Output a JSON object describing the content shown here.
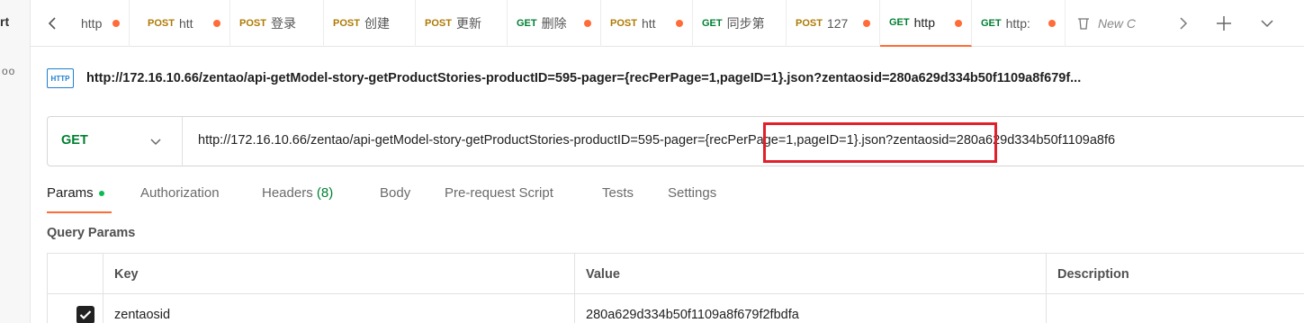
{
  "left_strip": {
    "label1": "rt",
    "label2": "oo"
  },
  "tabs": [
    {
      "method": "",
      "title": "http",
      "dot": true
    },
    {
      "method": "POST",
      "title": "htt",
      "dot": true
    },
    {
      "method": "POST",
      "title": "登录",
      "dot": false
    },
    {
      "method": "POST",
      "title": "创建",
      "dot": false
    },
    {
      "method": "POST",
      "title": "更新",
      "dot": false
    },
    {
      "method": "GET",
      "title": "删除",
      "dot": true
    },
    {
      "method": "POST",
      "title": "htt",
      "dot": true
    },
    {
      "method": "GET",
      "title": "同步第",
      "dot": false
    },
    {
      "method": "POST",
      "title": "127",
      "dot": true
    },
    {
      "method": "GET",
      "title": "http",
      "dot": true
    },
    {
      "method": "GET",
      "title": "http:",
      "dot": true
    }
  ],
  "new_tab_label": "New C",
  "request": {
    "badge": "HTTP",
    "title": "http://172.16.10.66/zentao/api-getModel-story-getProductStories-productID=595-pager={recPerPage=1,pageID=1}.json?zentaosid=280a629d334b50f1109a8f679f...",
    "method": "GET",
    "url": "http://172.16.10.66/zentao/api-getModel-story-getProductStories-productID=595-pager={recPerPage=1,pageID=1}.json?zentaosid=280a629d334b50f1109a8f6"
  },
  "subtabs": {
    "params": "Params",
    "authorization": "Authorization",
    "headers": "Headers",
    "headers_count": "(8)",
    "body": "Body",
    "prerequest": "Pre-request Script",
    "tests": "Tests",
    "settings": "Settings"
  },
  "query_params_label": "Query Params",
  "table": {
    "headers": {
      "key": "Key",
      "value": "Value",
      "description": "Description"
    },
    "rows": [
      {
        "checked": true,
        "key": "zentaosid",
        "value": "280a629d334b50f1109a8f679f2fbdfa",
        "description": ""
      }
    ]
  },
  "colors": {
    "accent": "#ff6c37",
    "get": "#007f31",
    "post": "#ad7a03",
    "highlight": "#e0202a"
  }
}
